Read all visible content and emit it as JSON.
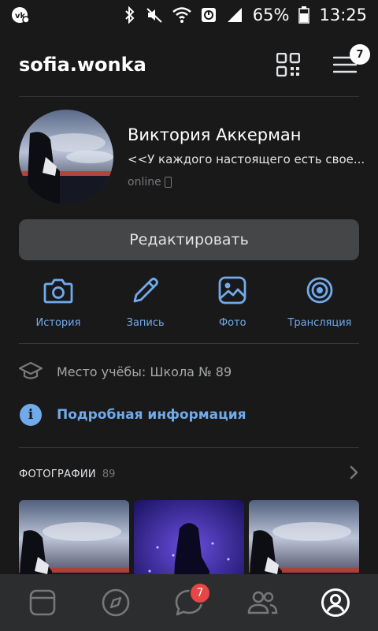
{
  "status_bar": {
    "battery_percent": "65%",
    "time": "13:25",
    "icons": [
      "vk-notification-icon",
      "bluetooth-icon",
      "mute-icon",
      "wifi-icon",
      "data-saver-icon",
      "signal-icon",
      "battery-icon"
    ]
  },
  "header": {
    "username": "sofia.wonka",
    "menu_badge": "7"
  },
  "profile": {
    "full_name": "Виктория Аккерман",
    "status": "<<У каждого настоящего есть свое...",
    "online": "online"
  },
  "edit_button": "Редактировать",
  "actions": [
    {
      "label": "История",
      "icon": "camera-icon"
    },
    {
      "label": "Запись",
      "icon": "pencil-icon"
    },
    {
      "label": "Фото",
      "icon": "image-icon"
    },
    {
      "label": "Трансляция",
      "icon": "broadcast-icon"
    }
  ],
  "education": "Место учёбы: Школа № 89",
  "details_link": "Подробная информация",
  "photos": {
    "title": "ФОТОГРАФИИ",
    "count": "89"
  },
  "tabbar": {
    "items": [
      "news-icon",
      "explore-icon",
      "messages-icon",
      "friends-icon",
      "profile-icon"
    ],
    "messages_badge": "7"
  },
  "colors": {
    "background": "#19191a",
    "accent": "#71aaeb",
    "button": "#454647",
    "badge_red": "#e64646",
    "tabbar": "#2c2d2e"
  }
}
